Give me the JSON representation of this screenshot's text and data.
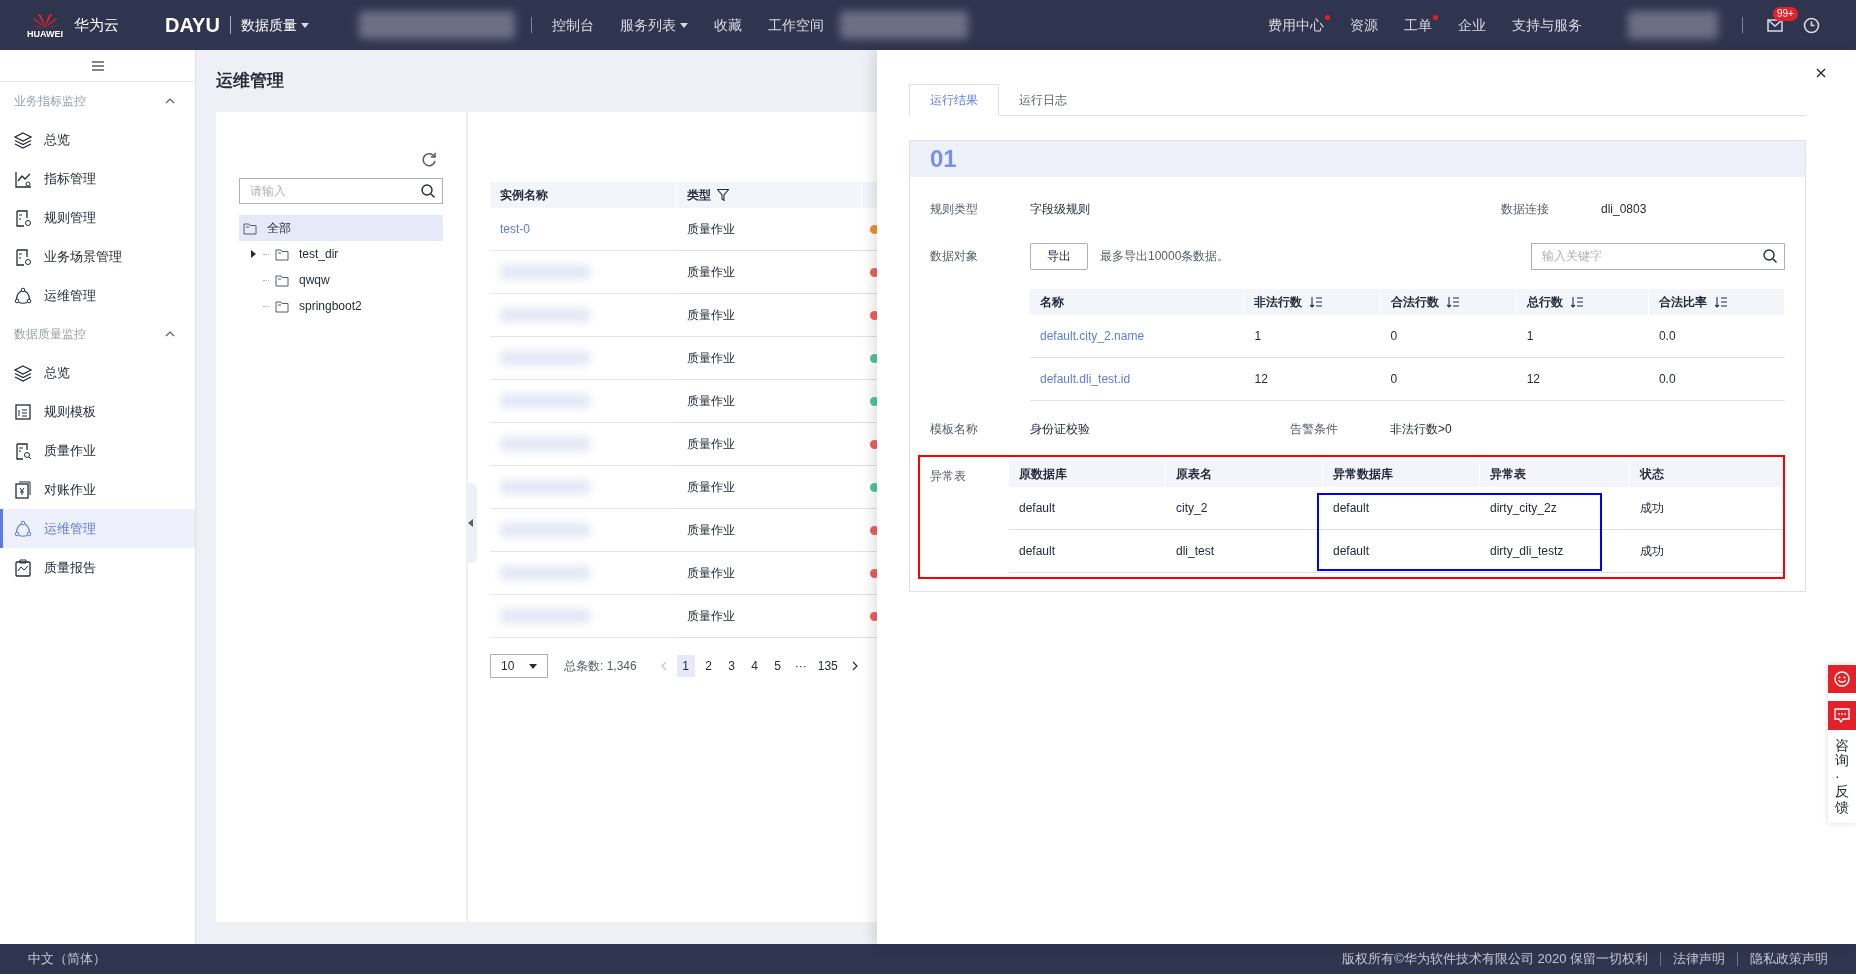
{
  "topbar": {
    "logo_text": "HUAWEI",
    "brand": "华为云",
    "product": "DAYU",
    "module": {
      "label": "数据质量",
      "dropdown": true
    },
    "nav": [
      {
        "label": "控制台",
        "dropdown": false
      },
      {
        "label": "服务列表",
        "dropdown": true
      },
      {
        "label": "收藏",
        "dropdown": false
      },
      {
        "label": "工作空间",
        "dropdown": false
      }
    ],
    "right_nav": [
      {
        "label": "费用中心",
        "dot": true
      },
      {
        "label": "资源",
        "dot": false
      },
      {
        "label": "工单",
        "dot": true
      },
      {
        "label": "企业",
        "dot": false
      },
      {
        "label": "支持与服务",
        "dot": false
      }
    ],
    "mail_badge": "99+"
  },
  "sidebar": {
    "sections": [
      {
        "title": "业务指标监控",
        "expanded": true,
        "items": [
          {
            "label": "总览",
            "selected": false
          },
          {
            "label": "指标管理",
            "selected": false
          },
          {
            "label": "规则管理",
            "selected": false
          },
          {
            "label": "业务场景管理",
            "selected": false
          },
          {
            "label": "运维管理",
            "selected": false
          }
        ]
      },
      {
        "title": "数据质量监控",
        "expanded": true,
        "items": [
          {
            "label": "总览",
            "selected": false
          },
          {
            "label": "规则模板",
            "selected": false
          },
          {
            "label": "质量作业",
            "selected": false
          },
          {
            "label": "对账作业",
            "selected": false
          },
          {
            "label": "运维管理",
            "selected": true
          },
          {
            "label": "质量报告",
            "selected": false
          }
        ]
      }
    ]
  },
  "page_title": "运维管理",
  "tree": {
    "placeholder": "请输入",
    "nodes": [
      {
        "label": "全部",
        "selected": true,
        "children": [
          {
            "label": "test_dir",
            "selected": false,
            "expanded": false
          },
          {
            "label": "qwqw",
            "selected": false
          },
          {
            "label": "springboot2",
            "selected": false
          }
        ]
      }
    ]
  },
  "instances": {
    "columns": [
      "实例名称",
      "类型"
    ],
    "rows": [
      {
        "name": "test-0",
        "type": "质量作业",
        "color": "#f0912f"
      },
      {
        "type": "质量作业",
        "color": "#ee6060"
      },
      {
        "type": "质量作业",
        "color": "#ee6060"
      },
      {
        "type": "质量作业",
        "color": "#4cc89a"
      },
      {
        "type": "质量作业",
        "color": "#4cc89a"
      },
      {
        "type": "质量作业",
        "color": "#ee6060"
      },
      {
        "type": "质量作业",
        "color": "#4cc89a"
      },
      {
        "type": "质量作业",
        "color": "#ee6060"
      },
      {
        "type": "质量作业",
        "color": "#ee6060"
      },
      {
        "type": "质量作业",
        "color": "#ee6060"
      }
    ],
    "pagination": {
      "page_size": "10",
      "total": "总条数: 1,346",
      "pages": [
        {
          "label": "1",
          "selected": true
        },
        {
          "label": "2",
          "selected": false
        },
        {
          "label": "3",
          "selected": false
        },
        {
          "label": "4",
          "selected": false
        },
        {
          "label": "5",
          "selected": false
        },
        {
          "label": "···",
          "selected": false
        },
        {
          "label": "135",
          "selected": false
        }
      ]
    }
  },
  "drawer": {
    "tabs": [
      {
        "label": "运行结果",
        "selected": true
      },
      {
        "label": "运行日志",
        "selected": false
      }
    ],
    "number": "01",
    "rule_type": {
      "label": "规则类型",
      "value": "字段级规则"
    },
    "connection": {
      "label": "数据连接",
      "value": "dli_0803"
    },
    "data_object": {
      "label": "数据对象",
      "button": "导出",
      "note": "最多导出10000条数据。",
      "search_placeholder": "输入关键字"
    },
    "objects_table": {
      "columns": [
        {
          "label": "名称",
          "sortable": false
        },
        {
          "label": "非法行数",
          "sortable": true
        },
        {
          "label": "合法行数",
          "sortable": true
        },
        {
          "label": "总行数",
          "sortable": true
        },
        {
          "label": "合法比率",
          "sortable": true
        }
      ],
      "rows": [
        [
          "default.city_2.name",
          "1",
          "0",
          "1",
          "0.0"
        ],
        [
          "default.dli_test.id",
          "12",
          "0",
          "12",
          "0.0"
        ]
      ]
    },
    "template": {
      "label": "模板名称",
      "value": "身份证校验"
    },
    "alarm": {
      "label": "告警条件",
      "value": "非法行数>0"
    },
    "anomaly": {
      "label": "异常表",
      "columns": [
        "原数据库",
        "原表名",
        "异常数据库",
        "异常表",
        "状态"
      ],
      "rows": [
        [
          "default",
          "city_2",
          "default",
          "dirty_city_2z",
          "成功"
        ],
        [
          "default",
          "dli_test",
          "default",
          "dirty_dli_testz",
          "成功"
        ]
      ]
    }
  },
  "float_help": "咨询·反馈",
  "footer": {
    "language": "中文（简体）",
    "copyright": "版权所有©华为软件技术有限公司 2020 保留一切权利",
    "links": [
      "法律声明",
      "隐私政策声明"
    ]
  }
}
